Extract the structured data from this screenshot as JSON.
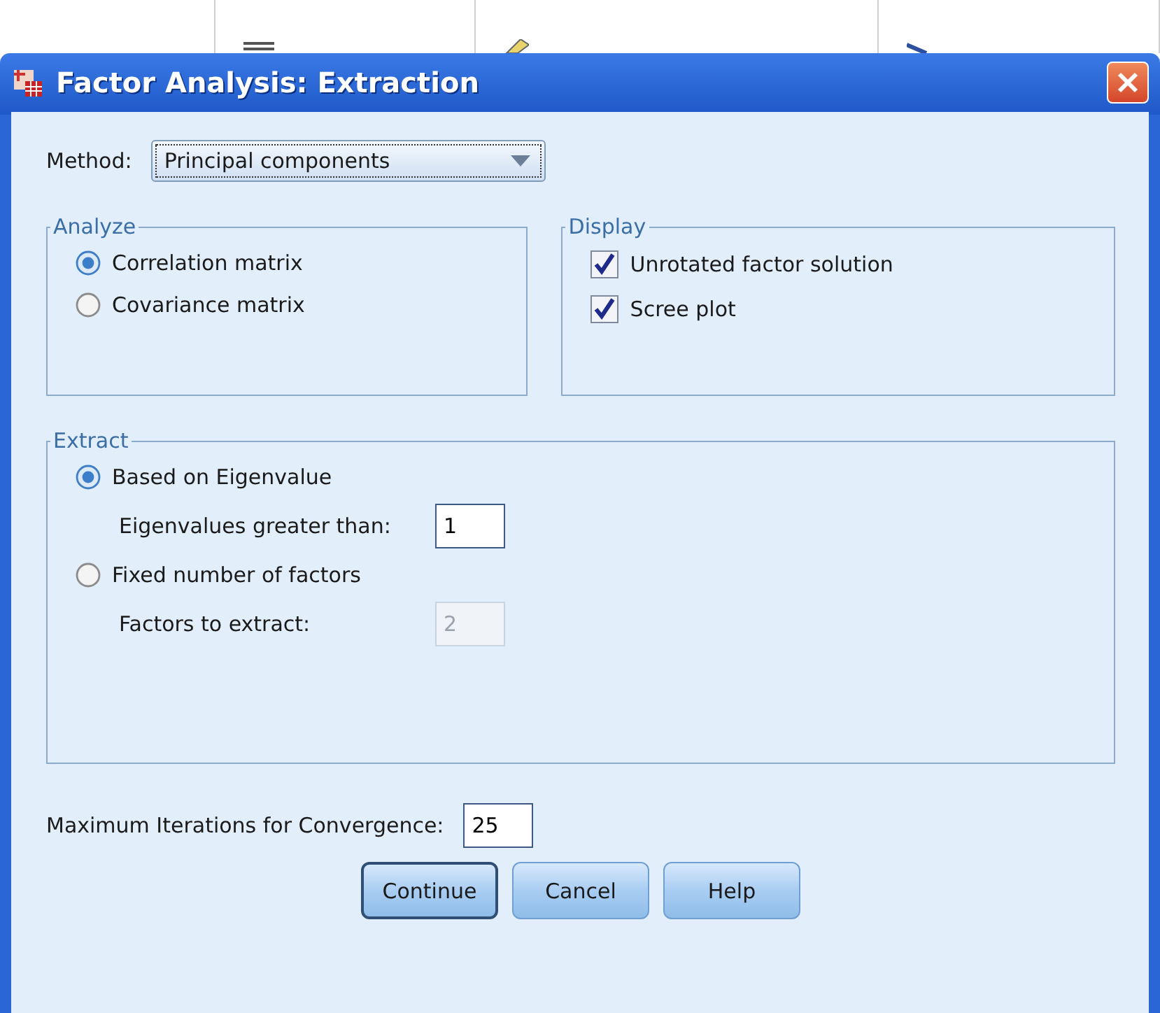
{
  "window": {
    "title": "Factor Analysis: Extraction"
  },
  "method": {
    "label": "Method:",
    "value": "Principal components"
  },
  "analyze": {
    "legend": "Analyze",
    "options": [
      {
        "label": "Correlation matrix",
        "selected": true
      },
      {
        "label": "Covariance matrix",
        "selected": false
      }
    ]
  },
  "display": {
    "legend": "Display",
    "options": [
      {
        "label": "Unrotated factor solution",
        "checked": true
      },
      {
        "label": "Scree plot",
        "checked": true
      }
    ]
  },
  "extract": {
    "legend": "Extract",
    "options": [
      {
        "label": "Based on Eigenvalue",
        "selected": true,
        "field_label": "Eigenvalues greater than:",
        "field_value": "1"
      },
      {
        "label": "Fixed number of factors",
        "selected": false,
        "field_label": "Factors to extract:",
        "field_value": "2"
      }
    ]
  },
  "iterations": {
    "label": "Maximum Iterations for Convergence:",
    "value": "25"
  },
  "buttons": [
    {
      "label": "Continue",
      "default": true
    },
    {
      "label": "Cancel",
      "default": false
    },
    {
      "label": "Help",
      "default": false
    }
  ]
}
